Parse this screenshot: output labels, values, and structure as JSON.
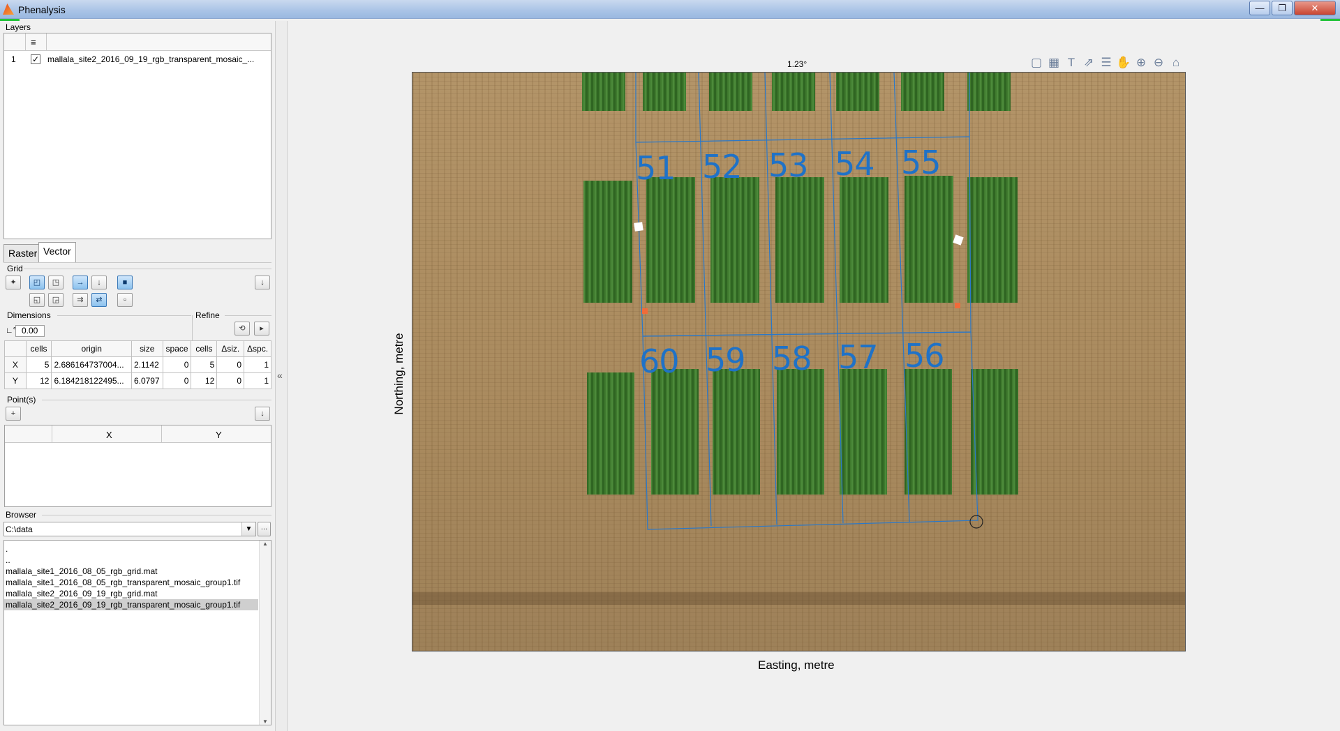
{
  "window": {
    "title": "Phenalysis"
  },
  "layers": {
    "label": "Layers",
    "header_icon": "≡",
    "rows": [
      {
        "index": "1",
        "checked": true,
        "name": "mallala_site2_2016_09_19_rgb_transparent_mosaic_..."
      }
    ]
  },
  "tabs": [
    {
      "label": "Raster"
    },
    {
      "label": "Vector"
    }
  ],
  "grid": {
    "label": "Grid",
    "dimensions_label": "Dimensions",
    "refine_label": "Refine",
    "angle_symbol": "∟°",
    "angle_value": "0.00",
    "headers": [
      "cells",
      "origin",
      "size",
      "space",
      "cells",
      "Δsiz.",
      "Δspc."
    ],
    "rows": [
      {
        "axis": "X",
        "cells": "5",
        "origin": "2.686164737004...",
        "size": "2.1142",
        "space": "0",
        "rcells": "5",
        "dsiz": "0",
        "dspc": "1"
      },
      {
        "axis": "Y",
        "cells": "12",
        "origin": "6.184218122495...",
        "size": "6.0797",
        "space": "0",
        "rcells": "12",
        "dsiz": "0",
        "dspc": "1"
      }
    ]
  },
  "points": {
    "label": "Point(s)",
    "headers": [
      "X",
      "Y"
    ]
  },
  "browser": {
    "label": "Browser",
    "path": "C:\\data",
    "browse_label": "...",
    "files": [
      {
        "name": "."
      },
      {
        "name": ".."
      },
      {
        "name": "mallala_site1_2016_08_05_rgb_grid.mat"
      },
      {
        "name": "mallala_site1_2016_08_05_rgb_transparent_mosaic_group1.tif"
      },
      {
        "name": "mallala_site2_2016_09_19_rgb_grid.mat"
      },
      {
        "name": "mallala_site2_2016_09_19_rgb_transparent_mosaic_group1.tif",
        "selected": true
      }
    ]
  },
  "plot": {
    "title": "1.23°",
    "xlabel": "Easting, metre",
    "ylabel": "Northing, metre",
    "top_row_labels": [
      "51",
      "52",
      "53",
      "54",
      "55"
    ],
    "bottom_row_labels": [
      "60",
      "59",
      "58",
      "57",
      "56"
    ]
  },
  "icons": {
    "toolbar": [
      "brush-icon",
      "grid-icon",
      "text-icon",
      "export-icon",
      "legend-icon",
      "pan-icon",
      "zoom-in-icon",
      "zoom-out-icon",
      "home-icon"
    ],
    "collapse": "«"
  }
}
